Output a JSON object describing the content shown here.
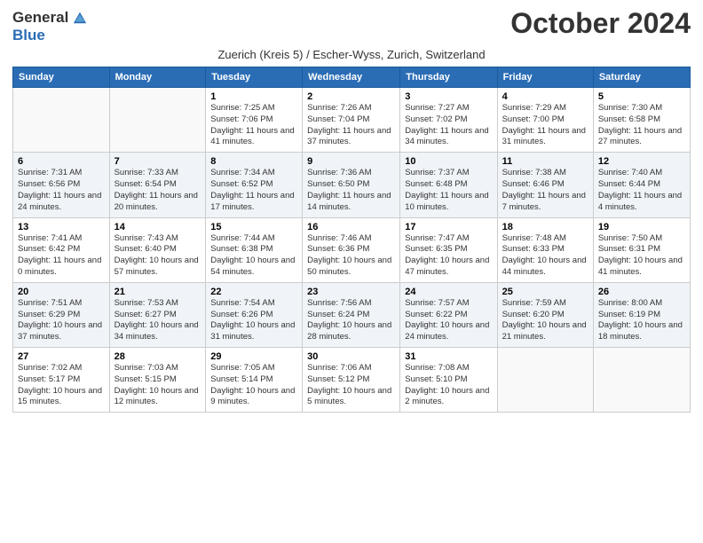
{
  "header": {
    "logo_general": "General",
    "logo_blue": "Blue",
    "month_title": "October 2024",
    "subtitle": "Zuerich (Kreis 5) / Escher-Wyss, Zurich, Switzerland"
  },
  "weekdays": [
    "Sunday",
    "Monday",
    "Tuesday",
    "Wednesday",
    "Thursday",
    "Friday",
    "Saturday"
  ],
  "weeks": [
    [
      {
        "day": "",
        "info": ""
      },
      {
        "day": "",
        "info": ""
      },
      {
        "day": "1",
        "info": "Sunrise: 7:25 AM\nSunset: 7:06 PM\nDaylight: 11 hours\nand 41 minutes."
      },
      {
        "day": "2",
        "info": "Sunrise: 7:26 AM\nSunset: 7:04 PM\nDaylight: 11 hours\nand 37 minutes."
      },
      {
        "day": "3",
        "info": "Sunrise: 7:27 AM\nSunset: 7:02 PM\nDaylight: 11 hours\nand 34 minutes."
      },
      {
        "day": "4",
        "info": "Sunrise: 7:29 AM\nSunset: 7:00 PM\nDaylight: 11 hours\nand 31 minutes."
      },
      {
        "day": "5",
        "info": "Sunrise: 7:30 AM\nSunset: 6:58 PM\nDaylight: 11 hours\nand 27 minutes."
      }
    ],
    [
      {
        "day": "6",
        "info": "Sunrise: 7:31 AM\nSunset: 6:56 PM\nDaylight: 11 hours\nand 24 minutes."
      },
      {
        "day": "7",
        "info": "Sunrise: 7:33 AM\nSunset: 6:54 PM\nDaylight: 11 hours\nand 20 minutes."
      },
      {
        "day": "8",
        "info": "Sunrise: 7:34 AM\nSunset: 6:52 PM\nDaylight: 11 hours\nand 17 minutes."
      },
      {
        "day": "9",
        "info": "Sunrise: 7:36 AM\nSunset: 6:50 PM\nDaylight: 11 hours\nand 14 minutes."
      },
      {
        "day": "10",
        "info": "Sunrise: 7:37 AM\nSunset: 6:48 PM\nDaylight: 11 hours\nand 10 minutes."
      },
      {
        "day": "11",
        "info": "Sunrise: 7:38 AM\nSunset: 6:46 PM\nDaylight: 11 hours\nand 7 minutes."
      },
      {
        "day": "12",
        "info": "Sunrise: 7:40 AM\nSunset: 6:44 PM\nDaylight: 11 hours\nand 4 minutes."
      }
    ],
    [
      {
        "day": "13",
        "info": "Sunrise: 7:41 AM\nSunset: 6:42 PM\nDaylight: 11 hours\nand 0 minutes."
      },
      {
        "day": "14",
        "info": "Sunrise: 7:43 AM\nSunset: 6:40 PM\nDaylight: 10 hours\nand 57 minutes."
      },
      {
        "day": "15",
        "info": "Sunrise: 7:44 AM\nSunset: 6:38 PM\nDaylight: 10 hours\nand 54 minutes."
      },
      {
        "day": "16",
        "info": "Sunrise: 7:46 AM\nSunset: 6:36 PM\nDaylight: 10 hours\nand 50 minutes."
      },
      {
        "day": "17",
        "info": "Sunrise: 7:47 AM\nSunset: 6:35 PM\nDaylight: 10 hours\nand 47 minutes."
      },
      {
        "day": "18",
        "info": "Sunrise: 7:48 AM\nSunset: 6:33 PM\nDaylight: 10 hours\nand 44 minutes."
      },
      {
        "day": "19",
        "info": "Sunrise: 7:50 AM\nSunset: 6:31 PM\nDaylight: 10 hours\nand 41 minutes."
      }
    ],
    [
      {
        "day": "20",
        "info": "Sunrise: 7:51 AM\nSunset: 6:29 PM\nDaylight: 10 hours\nand 37 minutes."
      },
      {
        "day": "21",
        "info": "Sunrise: 7:53 AM\nSunset: 6:27 PM\nDaylight: 10 hours\nand 34 minutes."
      },
      {
        "day": "22",
        "info": "Sunrise: 7:54 AM\nSunset: 6:26 PM\nDaylight: 10 hours\nand 31 minutes."
      },
      {
        "day": "23",
        "info": "Sunrise: 7:56 AM\nSunset: 6:24 PM\nDaylight: 10 hours\nand 28 minutes."
      },
      {
        "day": "24",
        "info": "Sunrise: 7:57 AM\nSunset: 6:22 PM\nDaylight: 10 hours\nand 24 minutes."
      },
      {
        "day": "25",
        "info": "Sunrise: 7:59 AM\nSunset: 6:20 PM\nDaylight: 10 hours\nand 21 minutes."
      },
      {
        "day": "26",
        "info": "Sunrise: 8:00 AM\nSunset: 6:19 PM\nDaylight: 10 hours\nand 18 minutes."
      }
    ],
    [
      {
        "day": "27",
        "info": "Sunrise: 7:02 AM\nSunset: 5:17 PM\nDaylight: 10 hours\nand 15 minutes."
      },
      {
        "day": "28",
        "info": "Sunrise: 7:03 AM\nSunset: 5:15 PM\nDaylight: 10 hours\nand 12 minutes."
      },
      {
        "day": "29",
        "info": "Sunrise: 7:05 AM\nSunset: 5:14 PM\nDaylight: 10 hours\nand 9 minutes."
      },
      {
        "day": "30",
        "info": "Sunrise: 7:06 AM\nSunset: 5:12 PM\nDaylight: 10 hours\nand 5 minutes."
      },
      {
        "day": "31",
        "info": "Sunrise: 7:08 AM\nSunset: 5:10 PM\nDaylight: 10 hours\nand 2 minutes."
      },
      {
        "day": "",
        "info": ""
      },
      {
        "day": "",
        "info": ""
      }
    ]
  ]
}
